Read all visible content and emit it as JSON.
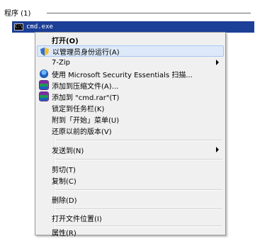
{
  "start_menu": {
    "group_header": "程序 (1)",
    "result": {
      "label": "cmd.exe",
      "icon": "cmd-icon",
      "icon_glyph": "C:\\"
    }
  },
  "context_menu": {
    "items": [
      {
        "label": "打开(O)",
        "bold": true
      },
      {
        "label": "以管理员身份运行(A)",
        "icon": "shield-icon",
        "highlighted": true
      },
      {
        "label": "7-Zip",
        "submenu": true
      },
      {
        "label": "使用 Microsoft Security Essentials 扫描...",
        "icon": "mse-icon"
      },
      {
        "label": "添加到压缩文件(A)...",
        "icon": "rar-icon"
      },
      {
        "label": "添加到 \"cmd.rar\"(T)",
        "icon": "rar-icon"
      },
      {
        "label": "锁定到任务栏(K)"
      },
      {
        "label": "附到「开始」菜单(U)"
      },
      {
        "label": "还原以前的版本(V)"
      },
      {
        "label": "发送到(N)",
        "submenu": true
      },
      {
        "label": "剪切(T)"
      },
      {
        "label": "复制(C)"
      },
      {
        "label": "删除(D)"
      },
      {
        "label": "打开文件位置(I)"
      },
      {
        "label": "属性(R)"
      }
    ]
  },
  "colors": {
    "selection_blue": "#1c3f97",
    "menu_background": "#f0f0f0",
    "menu_highlight": "#dde9f8"
  }
}
